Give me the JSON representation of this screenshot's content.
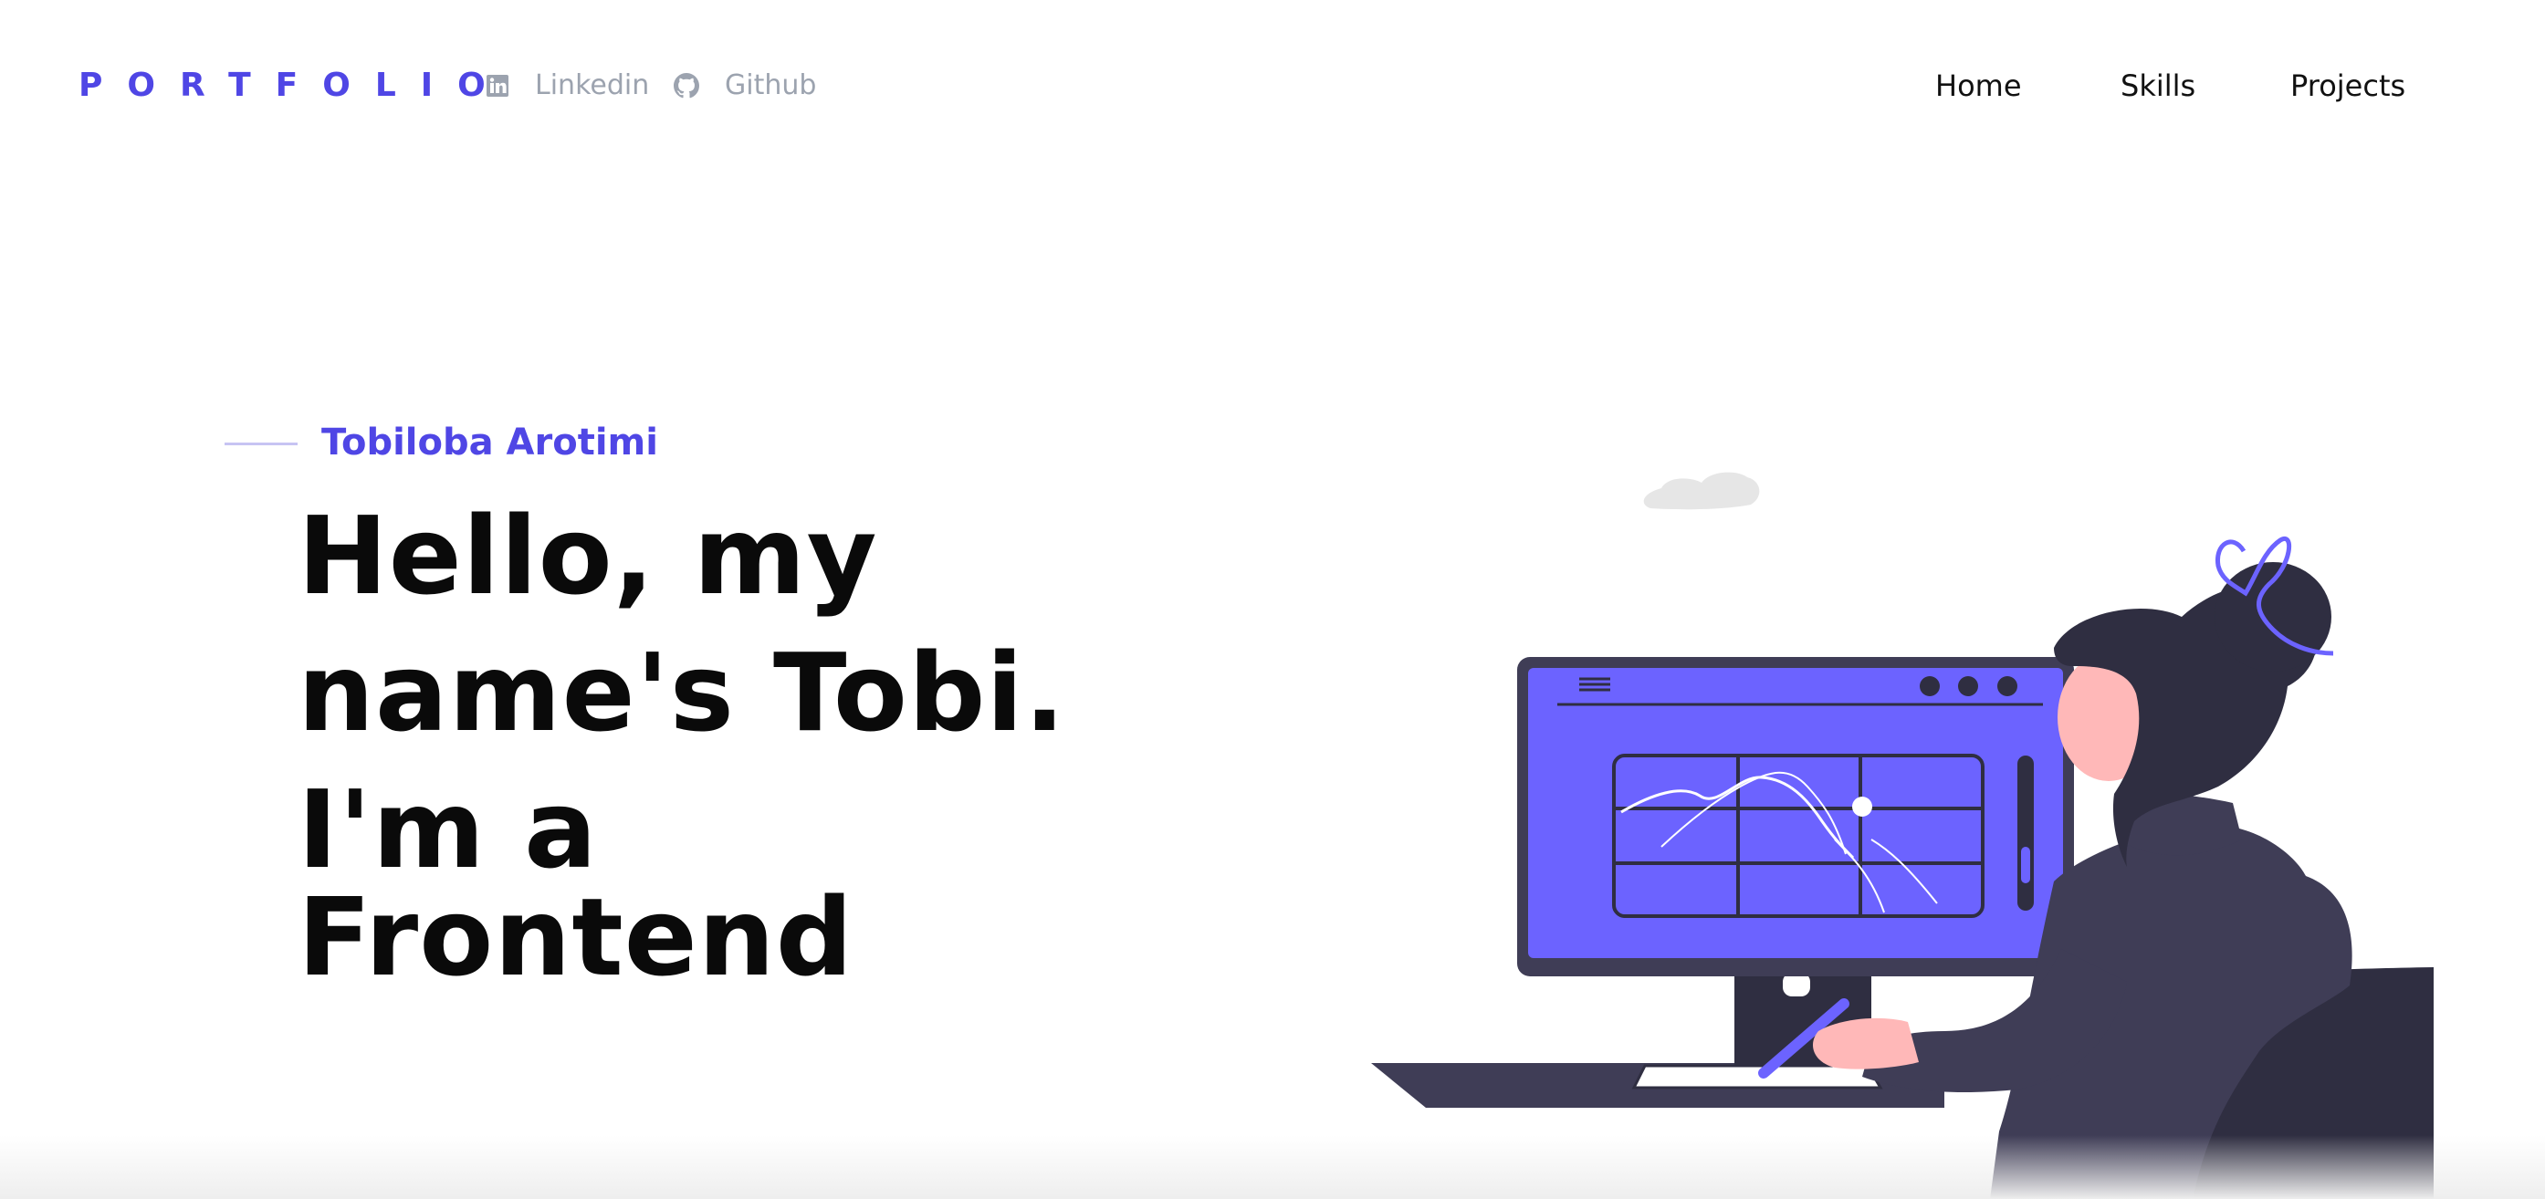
{
  "header": {
    "logo": "PORTFOLIO",
    "social_links": [
      {
        "label": "Linkedin",
        "icon": "linkedin-icon"
      },
      {
        "label": "Github",
        "icon": "github-icon"
      }
    ],
    "nav": [
      {
        "label": "Home"
      },
      {
        "label": "Skills"
      },
      {
        "label": "Projects"
      }
    ]
  },
  "hero": {
    "name": "Tobiloba Arotimi",
    "headline_lines": [
      "Hello, my",
      "name's Tobi.",
      "I'm a",
      "Frontend"
    ],
    "illustration": "woman-at-computer-illustration"
  },
  "colors": {
    "accent": "#4f46e5",
    "screen": "#6c63ff",
    "dark": "#3f3d56",
    "hair": "#2f2e41",
    "skin": "#ffb8b8",
    "muted": "#9ca3af"
  }
}
